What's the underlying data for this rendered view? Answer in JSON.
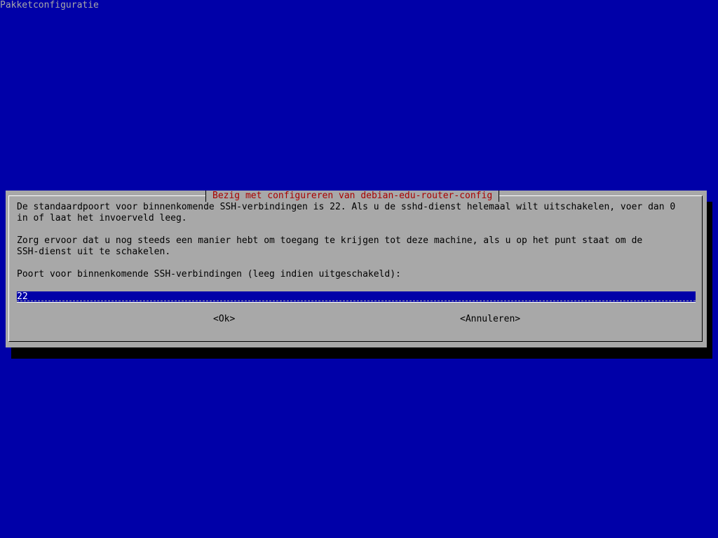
{
  "screen": {
    "title": "Pakketconfiguratie"
  },
  "dialog": {
    "title": "Bezig met configureren van debian-edu-router-config",
    "paragraph1": [
      "De standaardpoort voor binnenkomende SSH-verbindingen is 22. Als u de sshd-dienst helemaal wilt uitschakelen, voer dan 0",
      "in of laat het invoerveld leeg."
    ],
    "paragraph2": [
      "Zorg ervoor dat u nog steeds een manier hebt om toegang te krijgen tot deze machine, als u op het punt staat om de",
      "SSH-dienst uit te schakelen."
    ],
    "prompt": "Poort voor binnenkomende SSH-verbindingen (leeg indien uitgeschakeld):",
    "input_value": "22",
    "ok_label": "<Ok>",
    "cancel_label": "<Annuleren>"
  },
  "colors": {
    "background": "#0000a8",
    "dialog": "#a8a8a8",
    "title": "#a80000",
    "input": "#0000a8"
  }
}
